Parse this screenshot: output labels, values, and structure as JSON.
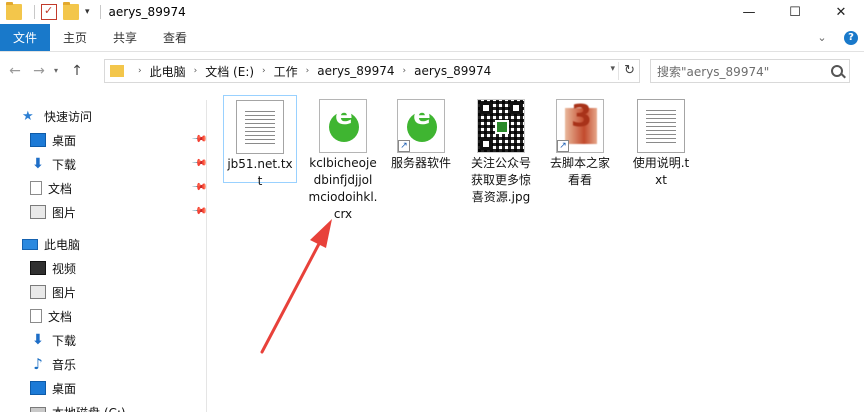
{
  "window": {
    "title": "aerys_89974",
    "controls": {
      "minimize": "—",
      "maximize": "☐",
      "close": "✕"
    }
  },
  "ribbon": {
    "file_tab": "文件",
    "tabs": [
      "主页",
      "共享",
      "查看"
    ],
    "help_icon": "?"
  },
  "address": {
    "breadcrumb": [
      "此电脑",
      "文档 (E:)",
      "工作",
      "aerys_89974",
      "aerys_89974"
    ],
    "search_placeholder": "搜索\"aerys_89974\""
  },
  "sidebar": {
    "quick_access_label": "快速访问",
    "quick_access": [
      {
        "label": "桌面",
        "icon": "desktop-icon",
        "pinned": true
      },
      {
        "label": "下载",
        "icon": "download-icon",
        "pinned": true
      },
      {
        "label": "文档",
        "icon": "document-icon",
        "pinned": true
      },
      {
        "label": "图片",
        "icon": "pictures-icon",
        "pinned": true
      }
    ],
    "this_pc_label": "此电脑",
    "this_pc": [
      {
        "label": "视频",
        "icon": "video-icon"
      },
      {
        "label": "图片",
        "icon": "pictures-icon"
      },
      {
        "label": "文档",
        "icon": "document-icon"
      },
      {
        "label": "下载",
        "icon": "download-icon"
      },
      {
        "label": "音乐",
        "icon": "music-icon"
      },
      {
        "label": "桌面",
        "icon": "desktop-icon"
      },
      {
        "label": "本地磁盘 (C:)",
        "icon": "disk-icon"
      }
    ]
  },
  "files": [
    {
      "name": "jb51.net.txt",
      "type": "text-file-icon",
      "selected": true
    },
    {
      "name": "kclbicheojedbinfjdjjolmciodoihkl.crx",
      "type": "crx-file-icon"
    },
    {
      "name": "服务器软件",
      "type": "shortcut-icon"
    },
    {
      "name": "关注公众号获取更多惊喜资源.jpg",
      "type": "qr-image-icon"
    },
    {
      "name": "去脚本之家看看",
      "type": "shortcut-icon"
    },
    {
      "name": "使用说明.txt",
      "type": "text-file-icon"
    }
  ],
  "annotation": {
    "arrow_color": "#e8413a"
  },
  "colors": {
    "accent": "#1979ca",
    "selection_border": "#99d1ff",
    "folder": "#f3c64b"
  }
}
